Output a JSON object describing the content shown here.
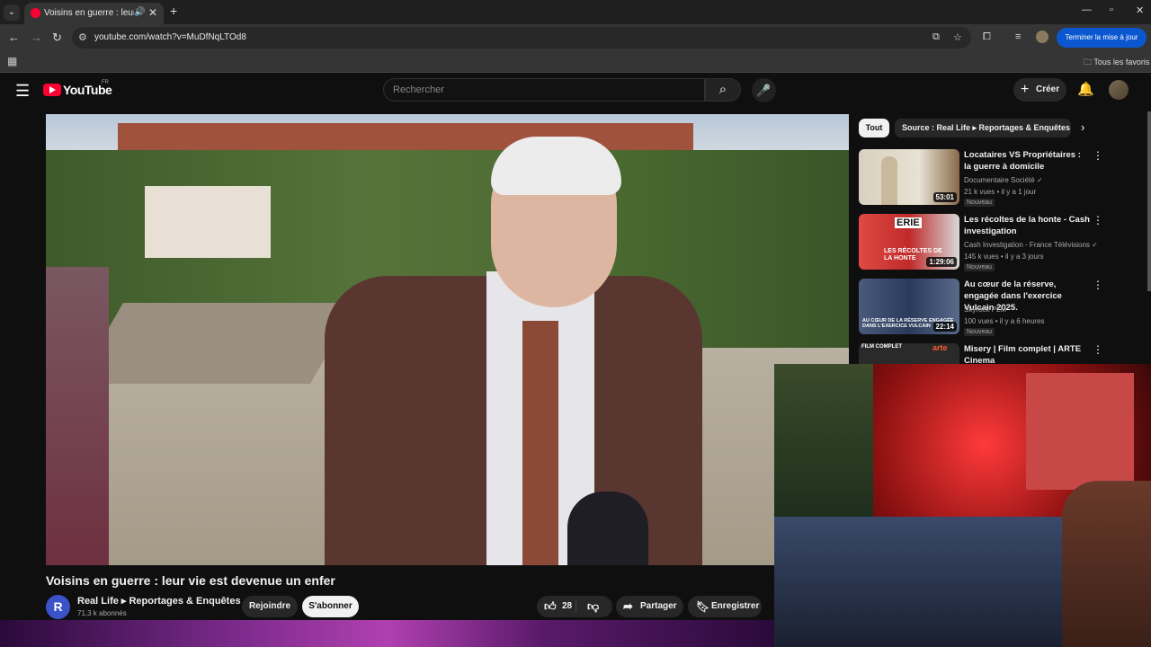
{
  "browser": {
    "tab_title": "Voisins en guerre : leur vie est devenue un enfer",
    "url": "youtube.com/watch?v=MuDfNqLTOd8",
    "update_button": "Terminer la mise à jour",
    "all_bookmarks": "Tous les favoris",
    "icons": [
      "tab-search-icon",
      "audio-icon",
      "close-icon",
      "plus-icon",
      "minimize-icon",
      "maximize-icon",
      "back-icon",
      "forward-icon",
      "reload-icon",
      "site-info-icon",
      "install-icon",
      "star-icon",
      "extensions-icon",
      "media-icon",
      "apps-icon",
      "folder-icon"
    ]
  },
  "youtube": {
    "logo_text": "YouTube",
    "country_code": "FR",
    "search_placeholder": "Rechercher",
    "create_label": "Créer",
    "video": {
      "title": "Voisins en guerre : leur vie est devenue un enfer",
      "channel_initial": "R",
      "channel_name": "Real Life ▸ Reportages & Enquêtes",
      "subscribers": "71,3 k abonnés",
      "join_label": "Rejoindre",
      "subscribe_label": "S'abonner",
      "likes": "28",
      "share_label": "Partager",
      "save_label": "Enregistrer"
    },
    "chips": {
      "all": "Tout",
      "source": "Source : Real Life ▸ Reportages & Enquêtes"
    },
    "recommendations": [
      {
        "title": "Locataires VS Propriétaires : la guerre à domicile",
        "channel": "Documentaire Société",
        "views": "21 k vues • il y a 1 jour",
        "badge": "Nouveau",
        "duration": "53:01"
      },
      {
        "title": "Les récoltes de la honte - Cash investigation",
        "channel": "Cash Investigation - France Télévisions",
        "views": "145 k vues • il y a 3 jours",
        "badge": "Nouveau",
        "duration": "1:29:06",
        "thumb_text_1": "ERIE",
        "thumb_text_2": "LES RÉCOLTES DE LA HONTE"
      },
      {
        "title": "Au cœur de la réserve, engagée dans l'exercice Vulcain 2025.",
        "channel": "Skyrock PLM",
        "views": "100 vues • il y a 6 heures",
        "badge": "Nouveau",
        "duration": "22:14",
        "thumb_text_1": "AU CŒUR DE LA RÉSERVE ENGAGÉE DANS L'EXERCICE VULCAIN"
      },
      {
        "title": "Misery | Film complet | ARTE Cinema",
        "thumb_text_1": "FILM COMPLET",
        "thumb_text_2": "arte"
      }
    ]
  }
}
